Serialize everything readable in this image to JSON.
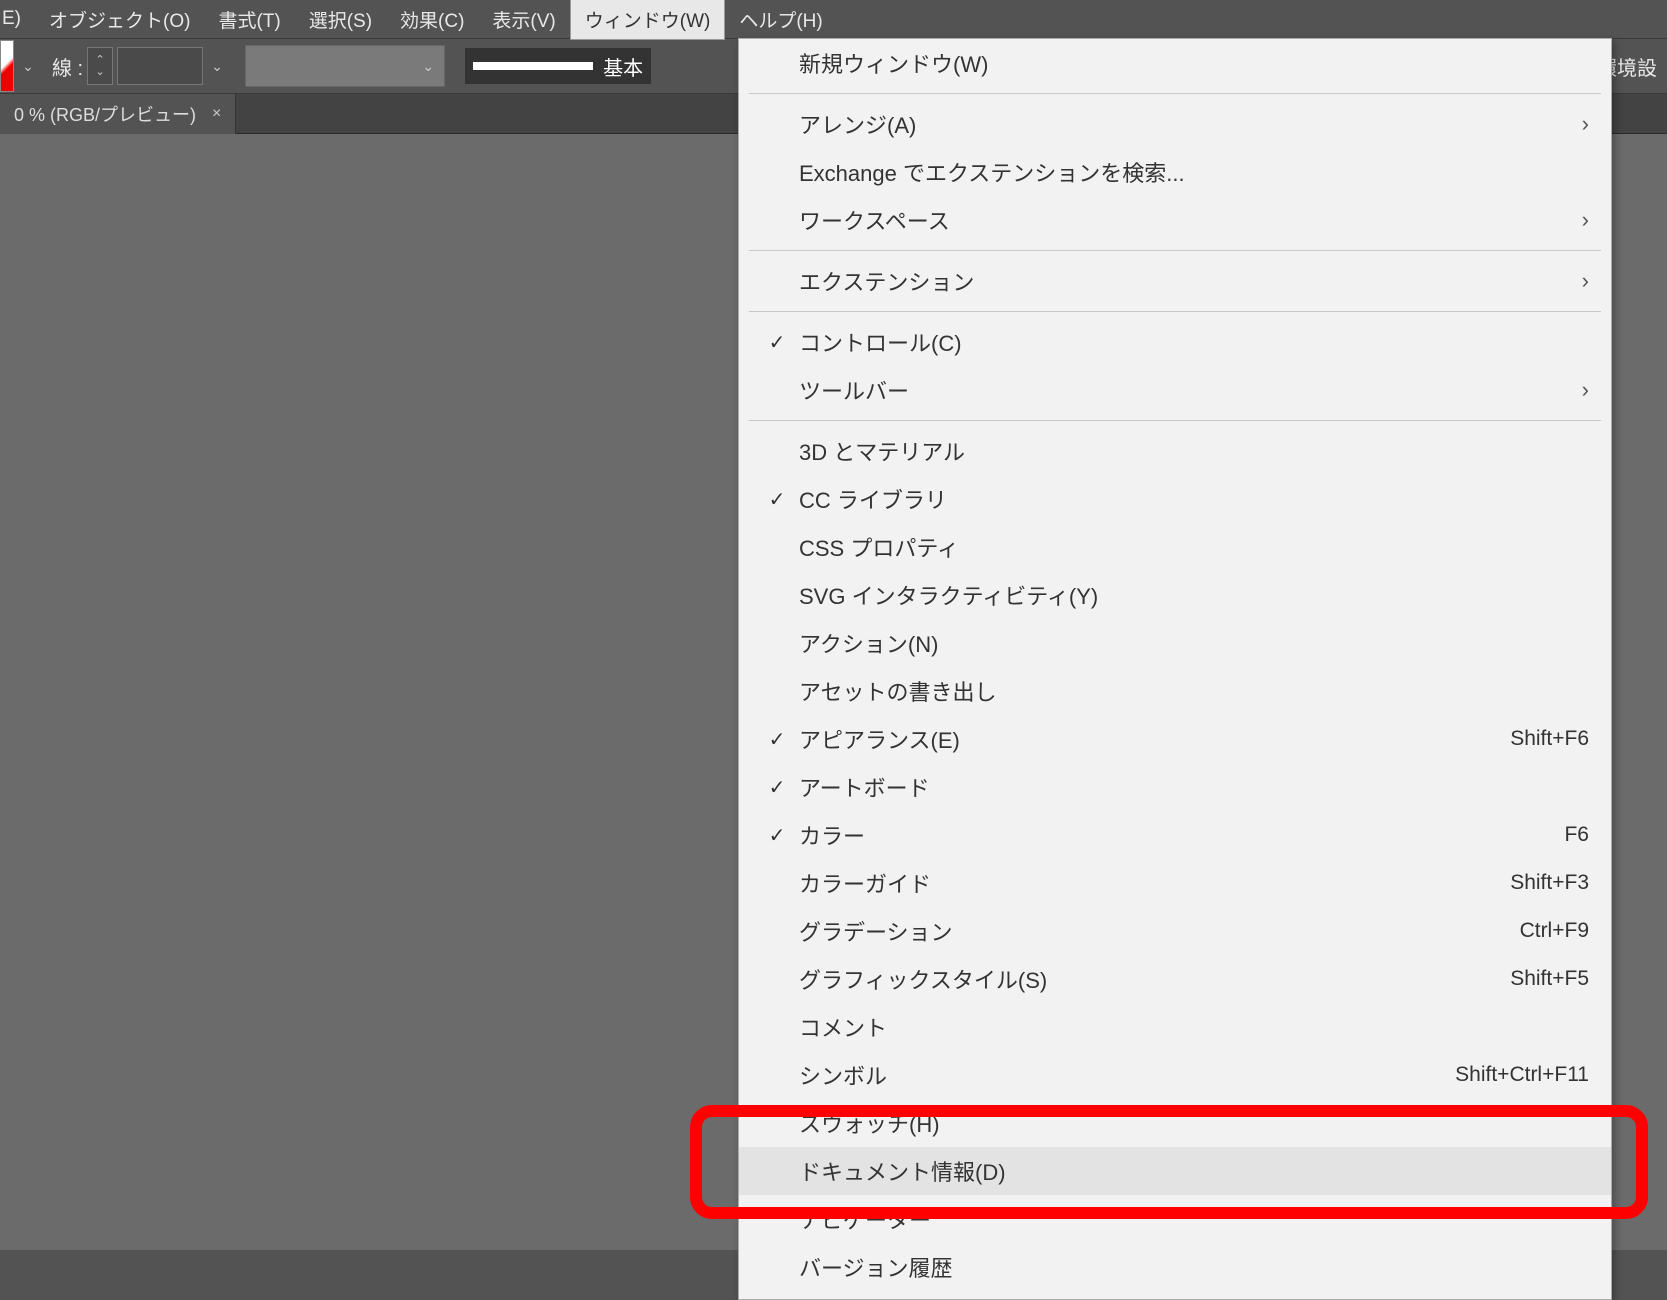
{
  "menubar": {
    "items": [
      {
        "label": "E)"
      },
      {
        "label": "オブジェクト(O)"
      },
      {
        "label": "書式(T)"
      },
      {
        "label": "選択(S)"
      },
      {
        "label": "効果(C)"
      },
      {
        "label": "表示(V)"
      },
      {
        "label": "ウィンドウ(W)",
        "active": true
      },
      {
        "label": "ヘルプ(H)"
      }
    ]
  },
  "toolbar": {
    "stroke_label": "線 :",
    "brush_label": "基本",
    "env_label": "環境設"
  },
  "doc_tab": {
    "title": "0 % (RGB/プレビュー)",
    "close": "×"
  },
  "dropdown": {
    "groups": [
      [
        {
          "label": "新規ウィンドウ(W)"
        }
      ],
      [
        {
          "label": "アレンジ(A)",
          "submenu": true
        },
        {
          "label": "Exchange でエクステンションを検索..."
        },
        {
          "label": "ワークスペース",
          "submenu": true
        }
      ],
      [
        {
          "label": "エクステンション",
          "submenu": true
        }
      ],
      [
        {
          "label": "コントロール(C)",
          "checked": true
        },
        {
          "label": "ツールバー",
          "submenu": true
        }
      ],
      [
        {
          "label": "3D とマテリアル"
        },
        {
          "label": "CC ライブラリ",
          "checked": true
        },
        {
          "label": "CSS プロパティ"
        },
        {
          "label": "SVG インタラクティビティ(Y)"
        },
        {
          "label": "アクション(N)"
        },
        {
          "label": "アセットの書き出し"
        },
        {
          "label": "アピアランス(E)",
          "checked": true,
          "shortcut": "Shift+F6"
        },
        {
          "label": "アートボード",
          "checked": true
        },
        {
          "label": "カラー",
          "checked": true,
          "shortcut": "F6"
        },
        {
          "label": "カラーガイド",
          "shortcut": "Shift+F3"
        },
        {
          "label": "グラデーション",
          "shortcut": "Ctrl+F9"
        },
        {
          "label": "グラフィックスタイル(S)",
          "shortcut": "Shift+F5"
        },
        {
          "label": "コメント"
        },
        {
          "label": "シンボル",
          "shortcut": "Shift+Ctrl+F11"
        },
        {
          "label": "スウォッチ(H)"
        },
        {
          "label": "ドキュメント情報(D)",
          "hovered": true
        },
        {
          "label": "ナビゲーター"
        },
        {
          "label": "バージョン履歴"
        }
      ]
    ]
  }
}
